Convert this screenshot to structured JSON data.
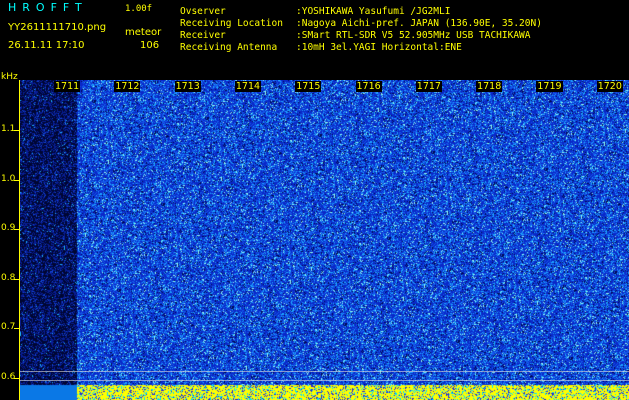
{
  "header": {
    "app_title": "HROFFT",
    "app_version": "1.00f",
    "file_name": "YY2611111710.png",
    "mode_label": "meteor",
    "date_time": "26.11.11 17:10",
    "count_value": "106"
  },
  "station_info": [
    {
      "key": "Ovserver",
      "value": ":YOSHIKAWA Yasufumi /JG2MLI"
    },
    {
      "key": "Receiving Location",
      "value": ":Nagoya Aichi-pref. JAPAN (136.90E, 35.20N)"
    },
    {
      "key": "Receiver",
      "value": ":SMart RTL-SDR V5 52.905MHz USB TACHIKAWA"
    },
    {
      "key": "Receiving Antenna",
      "value": ":10mH 3el.YAGI Horizontal:ENE"
    }
  ],
  "spectrogram": {
    "unit_label": "kHz",
    "y_ticks": [
      "1.1",
      "1.0",
      "0.9",
      "0.8",
      "0.7",
      "0.6"
    ],
    "y_values": [
      1.1,
      1.0,
      0.9,
      0.8,
      0.7,
      0.6
    ],
    "x_ticks": [
      "1711",
      "1712",
      "1713",
      "1714",
      "1715",
      "1716",
      "1717",
      "1718",
      "1719",
      "1720"
    ],
    "colors": {
      "noise_dark": "#000a5a",
      "noise_blue": "#0a2ad8",
      "noise_cyan": "#20d0ff",
      "baseline": "#ffff00",
      "text": "#ffff00"
    }
  }
}
